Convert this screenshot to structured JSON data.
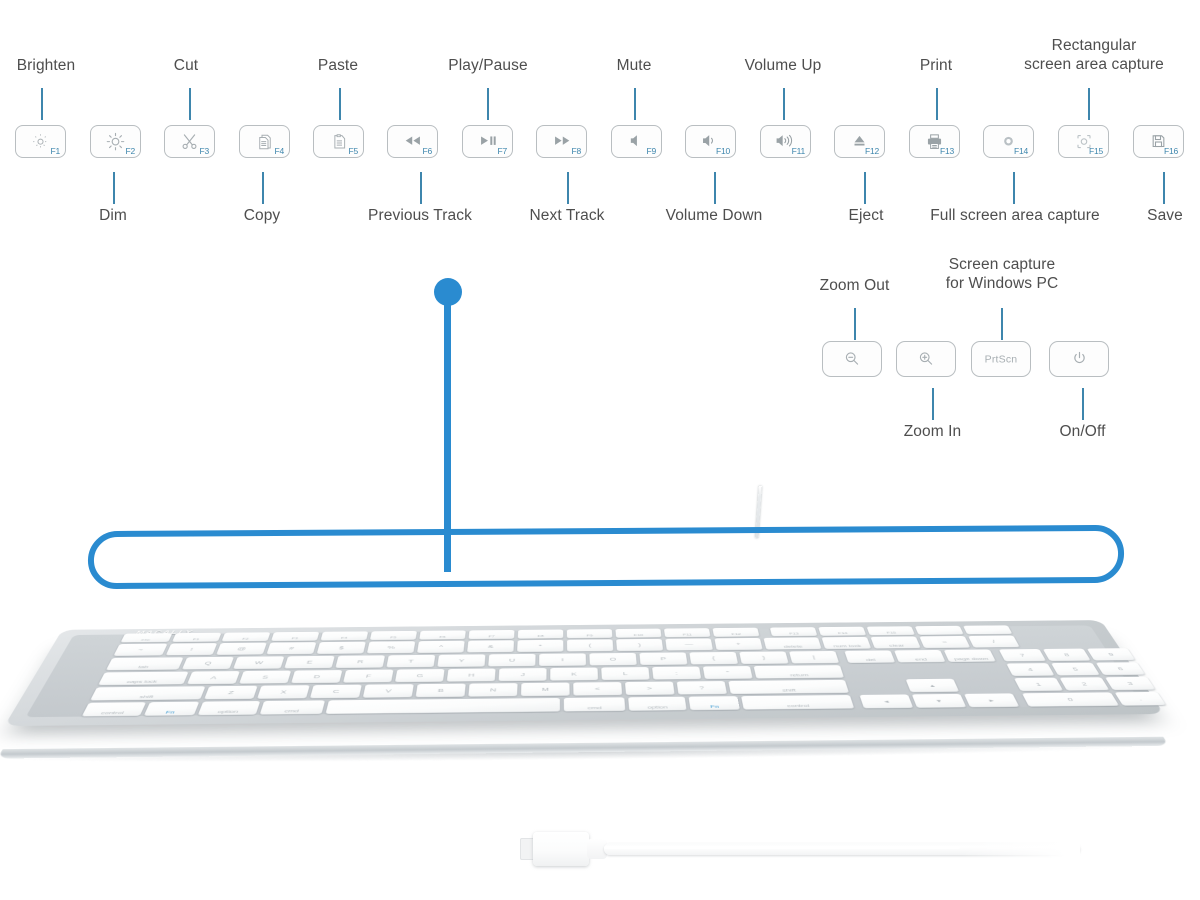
{
  "diagram": {
    "title": "Macally full-size keyboard function key guide",
    "accent_blue": "#2a8bd0",
    "leader_blue": "#3e86ad",
    "label_gray": "#4e4e4e",
    "key_border": "#b9bec1",
    "brand": "MACALLY"
  },
  "function_row": {
    "keys": [
      {
        "fn": "F1",
        "icon": "brightness-down-icon",
        "label": "Brighten",
        "label_position": "top"
      },
      {
        "fn": "F2",
        "icon": "brightness-up-icon",
        "label": "Dim",
        "label_position": "bottom"
      },
      {
        "fn": "F3",
        "icon": "scissors-cut-icon",
        "label": "Cut",
        "label_position": "top"
      },
      {
        "fn": "F4",
        "icon": "copy-pages-icon",
        "label": "Copy",
        "label_position": "bottom"
      },
      {
        "fn": "F5",
        "icon": "paste-clipboard-icon",
        "label": "Paste",
        "label_position": "top"
      },
      {
        "fn": "F6",
        "icon": "rewind-icon",
        "label": "Previous Track",
        "label_position": "bottom"
      },
      {
        "fn": "F7",
        "icon": "play-pause-icon",
        "label": "Play/Pause",
        "label_position": "top"
      },
      {
        "fn": "F8",
        "icon": "fast-forward-icon",
        "label": "Next Track",
        "label_position": "bottom"
      },
      {
        "fn": "F9",
        "icon": "mute-speaker-icon",
        "label": "Mute",
        "label_position": "top"
      },
      {
        "fn": "F10",
        "icon": "volume-low-icon",
        "label": "Volume Down",
        "label_position": "bottom"
      },
      {
        "fn": "F11",
        "icon": "volume-high-icon",
        "label": "Volume Up",
        "label_position": "top"
      },
      {
        "fn": "F12",
        "icon": "eject-icon",
        "label": "Eject",
        "label_position": "bottom"
      },
      {
        "fn": "F13",
        "icon": "printer-icon",
        "label": "Print",
        "label_position": "top"
      },
      {
        "fn": "F14",
        "icon": "fullscreen-capture-icon",
        "label": "Full screen area capture",
        "label_position": "bottom"
      },
      {
        "fn": "F15",
        "icon": "rectangular-capture-icon",
        "label": "Rectangular\nscreen area capture",
        "label_position": "top"
      },
      {
        "fn": "F16",
        "icon": "floppy-save-icon",
        "label": "Save",
        "label_position": "bottom"
      }
    ]
  },
  "utility_row": {
    "keys": [
      {
        "key_text": "",
        "icon": "zoom-out-icon",
        "label": "Zoom Out",
        "label_position": "top"
      },
      {
        "key_text": "",
        "icon": "zoom-in-icon",
        "label": "Zoom In",
        "label_position": "bottom"
      },
      {
        "key_text": "PrtScn",
        "icon": "prtscn-text",
        "label": "Screen capture\nfor Windows PC",
        "label_position": "top"
      },
      {
        "key_text": "",
        "icon": "power-icon",
        "label": "On/Off",
        "label_position": "bottom"
      }
    ]
  },
  "keyboard": {
    "brand_logo": "MACALLY",
    "rows": {
      "fn_row": [
        "esc",
        "",
        "",
        "",
        "",
        "",
        "",
        "",
        "",
        "",
        "",
        "",
        "",
        "",
        "",
        "",
        "",
        ""
      ],
      "number_row": [
        "~",
        "!",
        "@",
        "#",
        "$",
        "%",
        "^",
        "&",
        "*",
        "(",
        ")",
        "—",
        "+",
        "delete",
        "num",
        "clear",
        "=",
        "/",
        "*"
      ],
      "tab_row": [
        "tab",
        "Q",
        "W",
        "E",
        "R",
        "T",
        "Y",
        "U",
        "I",
        "O",
        "P",
        "{",
        "}",
        "|",
        "del",
        "end",
        "page down",
        "7",
        "8",
        "9",
        "—"
      ],
      "caps_row": [
        "caps lock",
        "A",
        "S",
        "D",
        "F",
        "G",
        "H",
        "J",
        "K",
        "L",
        ":",
        "\"",
        "return",
        "4",
        "5",
        "6",
        "+"
      ],
      "shift_row": [
        "shift",
        "Z",
        "X",
        "C",
        "V",
        "B",
        "N",
        "M",
        "<",
        ">",
        "?",
        "shift",
        "1",
        "2",
        "3"
      ],
      "bottom_row": [
        "control",
        "Fn",
        "option",
        "cmd",
        "",
        "cmd",
        "option",
        "Fn",
        "control",
        "0",
        ".",
        "enter"
      ]
    }
  },
  "accessory": {
    "cable_name": "usb-cable",
    "connector_name": "usb-connector"
  }
}
